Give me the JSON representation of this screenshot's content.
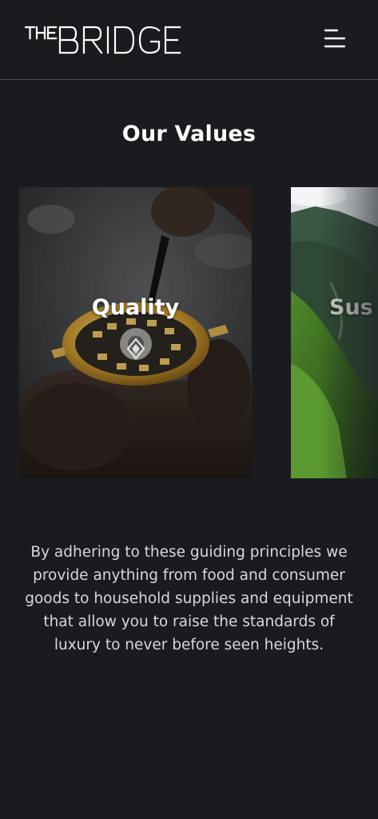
{
  "header": {
    "logo_text": "THE BRIDGE",
    "menu_icon": "hamburger-menu-icon"
  },
  "section": {
    "title": "Our Values",
    "cards": [
      {
        "label": "Quality",
        "image": "watch-repair-photo"
      },
      {
        "label": "Sus",
        "image": "green-mountain-landscape-photo"
      }
    ],
    "description": "By adhering to these guiding principles we provide anything from food and consumer goods to household supplies and equipment that allow you to raise the standards of luxury to never before seen heights."
  },
  "colors": {
    "background": "#1a1b1f",
    "text": "#ffffff",
    "body_text": "#d8d8da",
    "divider": "#4a4b50"
  }
}
